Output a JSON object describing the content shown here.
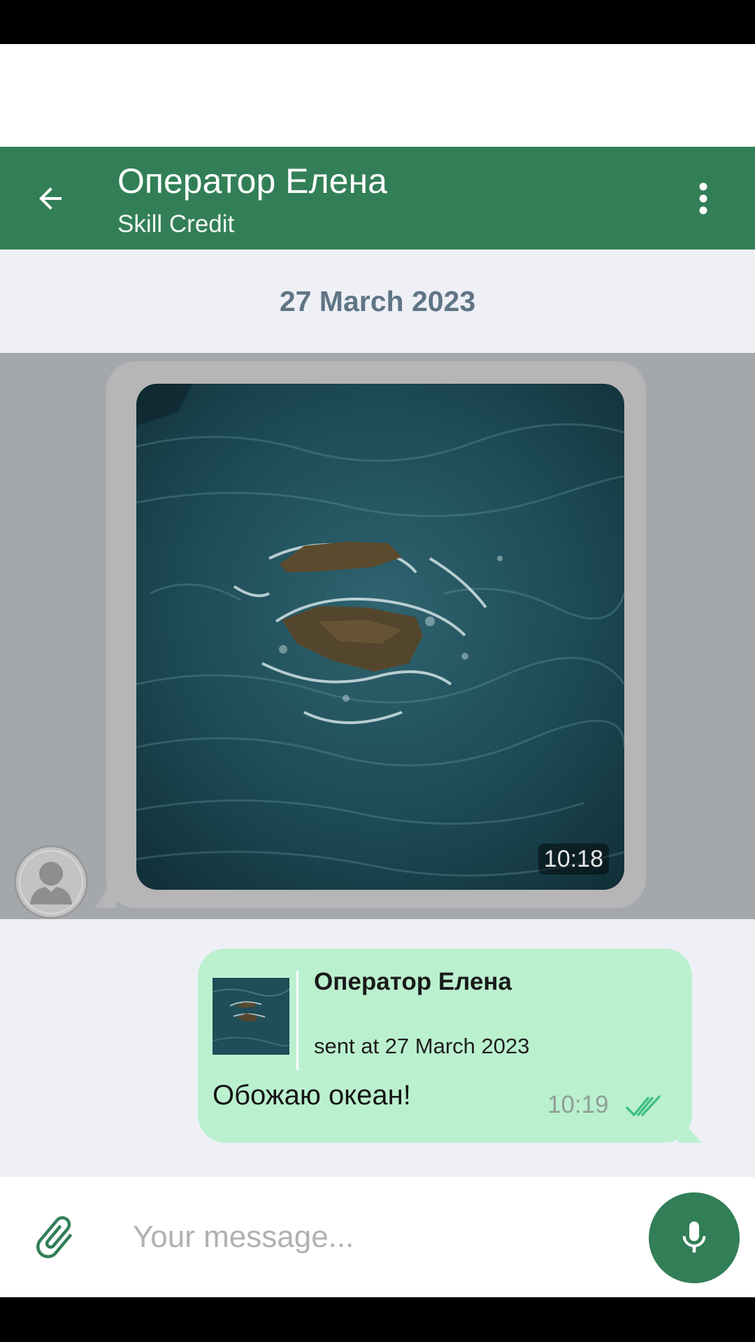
{
  "header": {
    "title": "Оператор Елена",
    "subtitle": "Skill Credit",
    "back_icon": "arrow-left-icon",
    "menu_icon": "more-vert-icon"
  },
  "chat": {
    "date_separator": "27 March 2023",
    "incoming_photo": {
      "time": "10:18",
      "avatar_icon": "person-icon"
    },
    "outgoing_message": {
      "reply": {
        "name": "Оператор Елена",
        "meta": "sent at 27 March 2023"
      },
      "text": "Обожаю океан!",
      "time": "10:19",
      "status_icon": "double-check-icon"
    }
  },
  "composer": {
    "placeholder": "Your message...",
    "attach_icon": "paperclip-icon",
    "mic_icon": "microphone-icon"
  },
  "colors": {
    "header_bg": "#327f57",
    "chat_bg": "#eef0f6",
    "selected_row": "#a4a8ad",
    "outgoing_bubble": "#bbf0cf",
    "date_text": "#5f7585",
    "accent": "#327f57"
  }
}
